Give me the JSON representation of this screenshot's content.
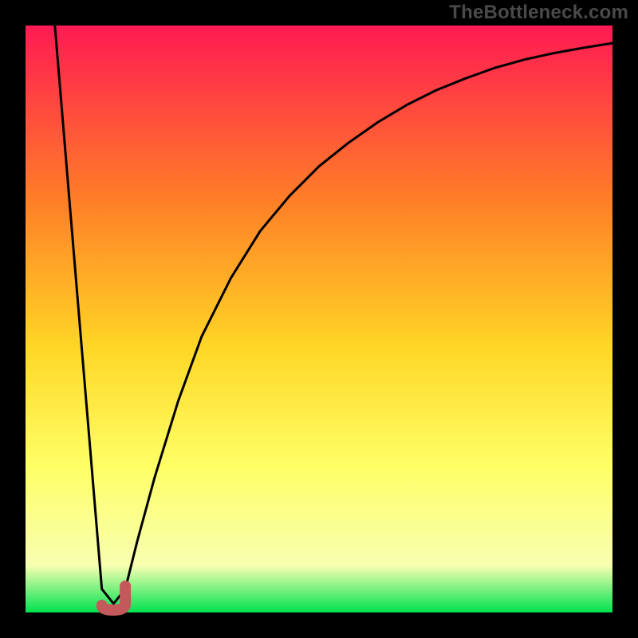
{
  "attribution": "TheBottleneck.com",
  "colors": {
    "bg_frame": "#000000",
    "gradient_top": "#ff1a53",
    "gradient_mid1": "#ff7f27",
    "gradient_mid2": "#ffd726",
    "gradient_mid3": "#ffff66",
    "gradient_mid4": "#f7ffb0",
    "gradient_bottom": "#00e24f",
    "curve": "#000000",
    "marker": "#c4595b"
  },
  "chart_data": {
    "type": "line",
    "title": "",
    "xlabel": "",
    "ylabel": "",
    "xlim": [
      0,
      100
    ],
    "ylim": [
      0,
      100
    ],
    "grid": false,
    "legend": false,
    "minimum_region": {
      "x_start": 13.0,
      "x_end": 17.0,
      "y": 1.5
    },
    "series": [
      {
        "name": "bottleneck-curve",
        "x": [
          5,
          7,
          9,
          11,
          13,
          15,
          17,
          19,
          22,
          26,
          30,
          35,
          40,
          45,
          50,
          55,
          60,
          65,
          70,
          75,
          80,
          85,
          90,
          95,
          100
        ],
        "y": [
          100,
          76,
          52,
          28,
          4,
          1.5,
          4,
          12,
          23,
          36,
          47,
          57,
          65,
          71,
          76,
          80,
          83.5,
          86.5,
          89,
          91,
          92.8,
          94.2,
          95.3,
          96.2,
          97
        ]
      }
    ]
  }
}
